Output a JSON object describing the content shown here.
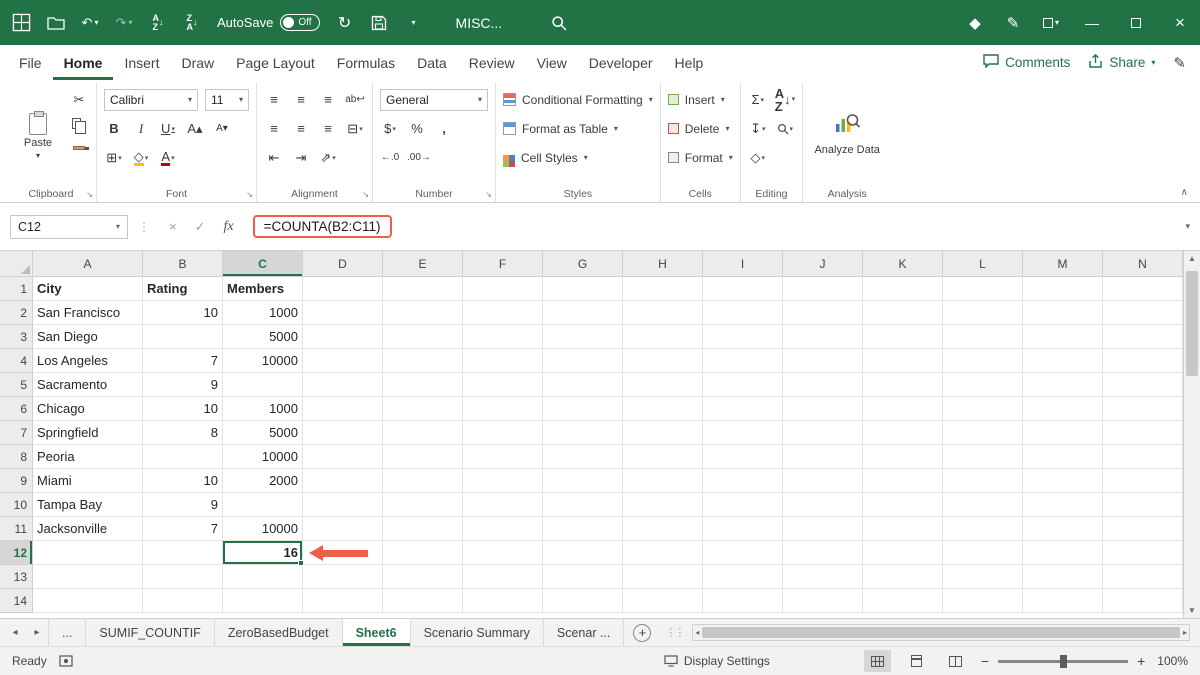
{
  "titlebar": {
    "autosave_label": "AutoSave",
    "autosave_state": "Off",
    "title": "MISC..."
  },
  "ribbon_tabs": {
    "items": [
      "File",
      "Home",
      "Insert",
      "Draw",
      "Page Layout",
      "Formulas",
      "Data",
      "Review",
      "View",
      "Developer",
      "Help"
    ],
    "active": "Home",
    "comments_label": "Comments",
    "share_label": "Share"
  },
  "ribbon": {
    "clipboard": {
      "label": "Clipboard",
      "paste_label": "Paste"
    },
    "font": {
      "label": "Font",
      "name": "Calibri",
      "size": "11"
    },
    "alignment": {
      "label": "Alignment"
    },
    "number": {
      "label": "Number",
      "format": "General"
    },
    "styles": {
      "label": "Styles",
      "items": [
        "Conditional Formatting",
        "Format as Table",
        "Cell Styles"
      ]
    },
    "cells": {
      "label": "Cells",
      "items": [
        "Insert",
        "Delete",
        "Format"
      ]
    },
    "editing": {
      "label": "Editing"
    },
    "analysis": {
      "label": "Analysis",
      "analyze_label": "Analyze Data"
    }
  },
  "formula_bar": {
    "name_box": "C12",
    "formula": "=COUNTA(B2:C11)"
  },
  "grid": {
    "columns": [
      "A",
      "B",
      "C",
      "D",
      "E",
      "F",
      "G",
      "H",
      "I",
      "J",
      "K",
      "L",
      "M",
      "N"
    ],
    "row_count": 14,
    "selected_cell": "C12",
    "cells": {
      "A1": "City",
      "B1": "Rating",
      "C1": "Members",
      "A2": "San Francisco",
      "B2": "10",
      "C2": "1000",
      "A3": "San Diego",
      "C3": "5000",
      "A4": "Los Angeles",
      "B4": "7",
      "C4": "10000",
      "A5": "Sacramento",
      "B5": "9",
      "A6": "Chicago",
      "B6": "10",
      "C6": "1000",
      "A7": "Springfield",
      "B7": "8",
      "C7": "5000",
      "A8": "Peoria",
      "C8": "10000",
      "A9": "Miami",
      "B9": "10",
      "C9": "2000",
      "A10": "Tampa Bay",
      "B10": "9",
      "A11": "Jacksonville",
      "B11": "7",
      "C11": "10000",
      "C12": "16"
    }
  },
  "sheet_tabs": {
    "items": [
      "...",
      "SUMIF_COUNTIF",
      "ZeroBasedBudget",
      "Sheet6",
      "Scenario Summary",
      "Scenar ..."
    ],
    "active": "Sheet6"
  },
  "status_bar": {
    "ready": "Ready",
    "display_settings": "Display Settings",
    "zoom": "100%"
  },
  "colors": {
    "excel_green": "#217346",
    "arrow_red": "#ed5e4d"
  }
}
